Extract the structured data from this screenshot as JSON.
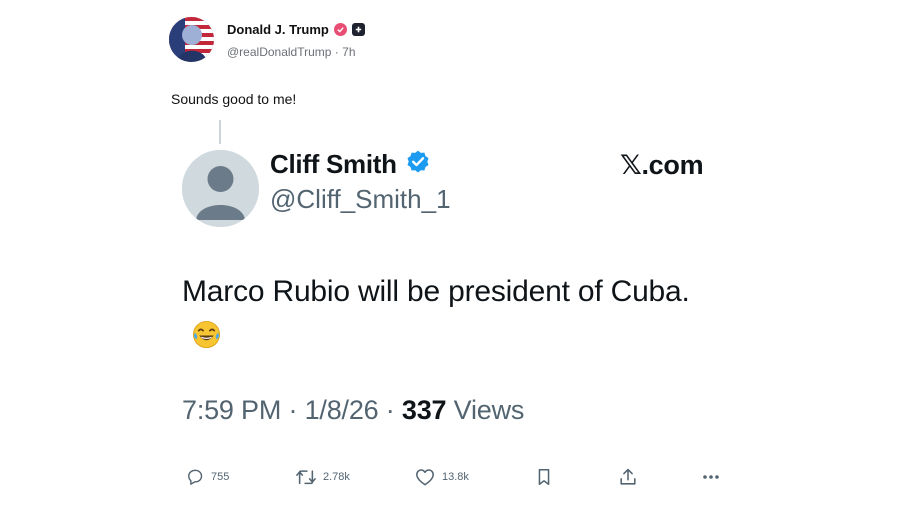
{
  "post": {
    "author_name": "Donald J. Trump",
    "handle": "@realDonaldTrump",
    "separator": "·",
    "time_ago": "7h",
    "body": "Sounds good to me!"
  },
  "quoted": {
    "author_name": "Cliff Smith",
    "handle": "@Cliff_Smith_1",
    "watermark": "𝕏.com",
    "text": "Marco Rubio will be president of Cuba.",
    "emoji": "face-with-tears-of-joy",
    "time": "7:59 PM",
    "sep1": "·",
    "date": "1/8/26",
    "sep2": "·",
    "views_count": "337",
    "views_label": "Views"
  },
  "actions": {
    "replies": "755",
    "reposts": "2.78k",
    "likes": "13.8k"
  },
  "colors": {
    "verified_blue": "#1d9bf0",
    "verified_pink": "#e84d74",
    "secondary_text": "#536471"
  }
}
